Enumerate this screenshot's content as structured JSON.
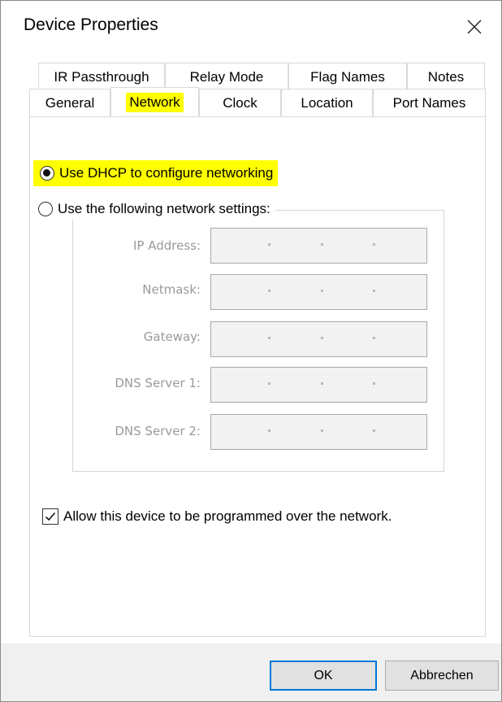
{
  "window": {
    "title": "Device Properties"
  },
  "tabs": {
    "row1": [
      "IR Passthrough",
      "Relay Mode",
      "Flag Names",
      "Notes"
    ],
    "row2": [
      "General",
      "Network",
      "Clock",
      "Location",
      "Port Names"
    ],
    "active": "Network"
  },
  "network": {
    "dhcp_label": "Use DHCP to configure networking",
    "manual_label": "Use the following network settings:",
    "selected": "dhcp",
    "fields": [
      {
        "label": "IP Address:",
        "value": ". . ."
      },
      {
        "label": "Netmask:",
        "value": ". . ."
      },
      {
        "label": "Gateway:",
        "value": ". . ."
      },
      {
        "label": "DNS Server 1:",
        "value": ". . ."
      },
      {
        "label": "DNS Server 2:",
        "value": ". . ."
      }
    ],
    "allow_program_label": "Allow this device to be programmed over the network.",
    "allow_program_checked": true
  },
  "buttons": {
    "ok": "OK",
    "cancel": "Abbrechen"
  },
  "colors": {
    "highlight": "#ffff00",
    "default_button_border": "#0078d7"
  }
}
